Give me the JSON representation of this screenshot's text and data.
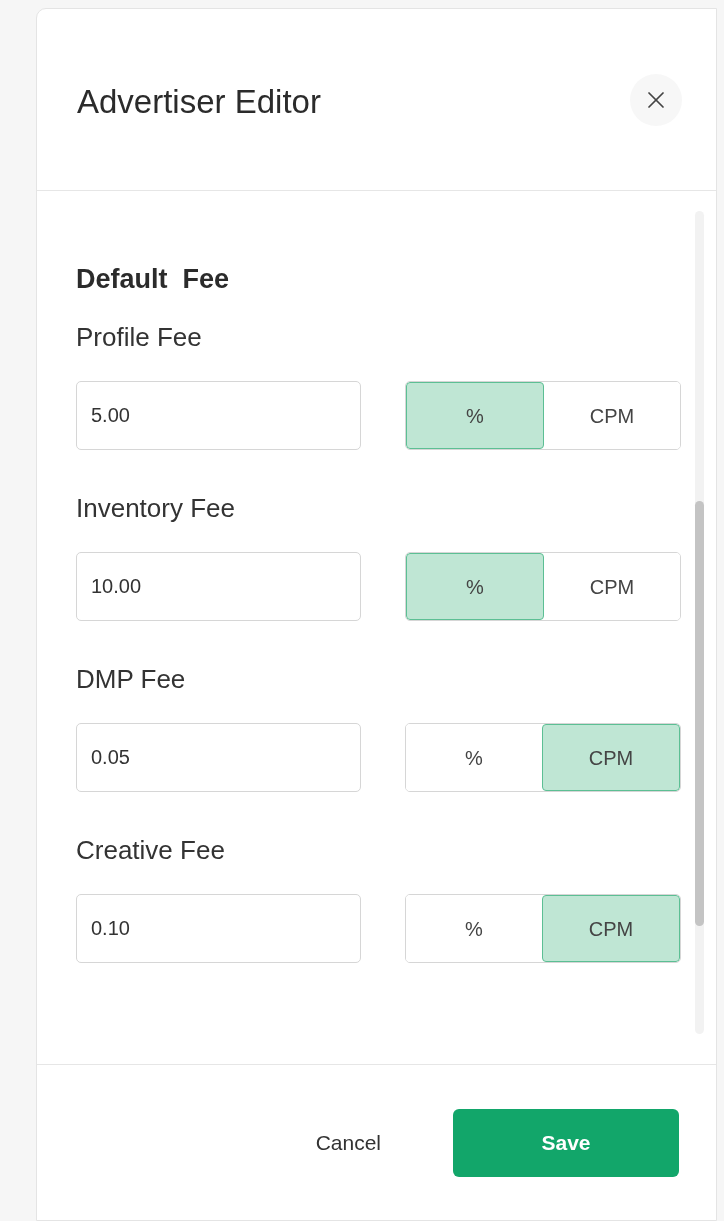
{
  "dialog": {
    "title": "Advertiser Editor"
  },
  "section": {
    "title": "Default  Fee"
  },
  "fees": [
    {
      "label": "Profile Fee",
      "value": "5.00",
      "units": [
        {
          "label": "%",
          "selected": true
        },
        {
          "label": "CPM",
          "selected": false
        }
      ]
    },
    {
      "label": "Inventory Fee",
      "value": "10.00",
      "units": [
        {
          "label": "%",
          "selected": true
        },
        {
          "label": "CPM",
          "selected": false
        }
      ]
    },
    {
      "label": "DMP Fee",
      "value": "0.05",
      "units": [
        {
          "label": "%",
          "selected": false
        },
        {
          "label": "CPM",
          "selected": true
        }
      ]
    },
    {
      "label": "Creative Fee",
      "value": "0.10",
      "units": [
        {
          "label": "%",
          "selected": false
        },
        {
          "label": "CPM",
          "selected": true
        }
      ]
    }
  ],
  "footer": {
    "cancel": "Cancel",
    "save": "Save"
  }
}
